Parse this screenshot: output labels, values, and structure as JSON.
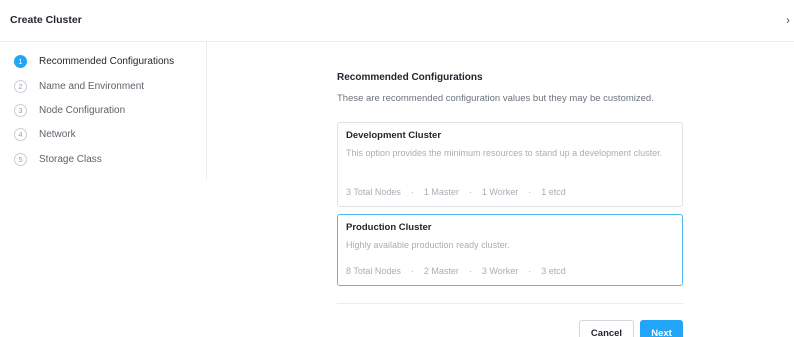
{
  "dialog": {
    "title": "Create Cluster",
    "close_glyph": "›"
  },
  "steps": [
    {
      "num": "1",
      "label": "Recommended Configurations",
      "active": true
    },
    {
      "num": "2",
      "label": "Name and Environment",
      "active": false
    },
    {
      "num": "3",
      "label": "Node Configuration",
      "active": false
    },
    {
      "num": "4",
      "label": "Network",
      "active": false
    },
    {
      "num": "5",
      "label": "Storage Class",
      "active": false
    }
  ],
  "main": {
    "title": "Recommended Configurations",
    "subtitle": "These are recommended configuration values but they may be customized.",
    "cards": [
      {
        "title": "Development Cluster",
        "description": "This option provides the minimum resources to stand up a development cluster.",
        "stats": [
          "3 Total Nodes",
          "1 Master",
          "1 Worker",
          "1 etcd"
        ],
        "selected": false
      },
      {
        "title": "Production Cluster",
        "description": "Highly available production ready cluster.",
        "stats": [
          "8 Total Nodes",
          "2 Master",
          "3 Worker",
          "3 etcd"
        ],
        "selected": true
      }
    ],
    "separator": "·"
  },
  "footer": {
    "cancel_label": "Cancel",
    "next_label": "Next"
  },
  "colors": {
    "accent": "#22a5f7",
    "selected_border": "#4fb6f0"
  }
}
